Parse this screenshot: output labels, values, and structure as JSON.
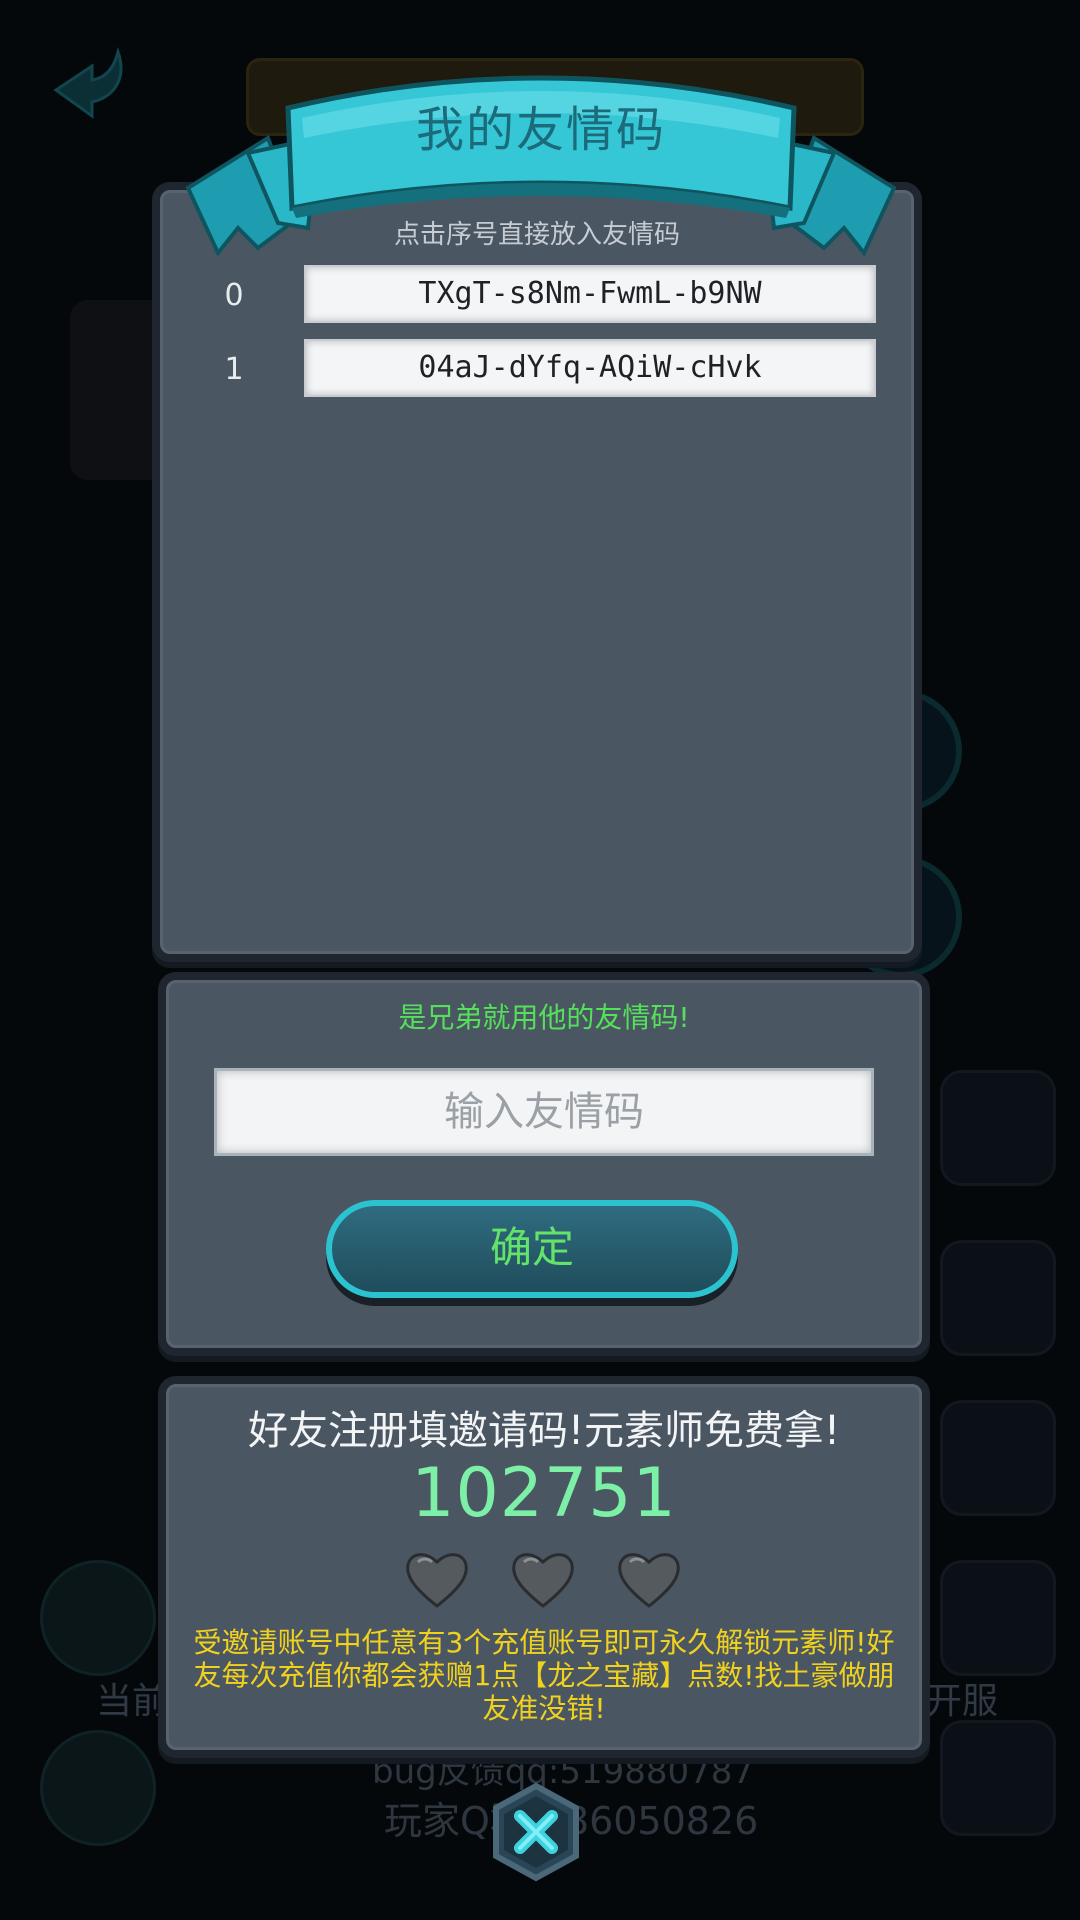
{
  "background": {
    "left_label": "当前",
    "right_label": "开服",
    "bug_line": "bug反馈qq:519880787",
    "player_line": "玩家Q群:486050826"
  },
  "modal": {
    "title": "我的友情码",
    "hint": "点击序号直接放入友情码",
    "codes": [
      {
        "index": "0",
        "code": "TXgT-s8Nm-FwmL-b9NW"
      },
      {
        "index": "1",
        "code": "04aJ-dYfq-AQiW-cHvk"
      }
    ]
  },
  "input_panel": {
    "prompt": "是兄弟就用他的友情码!",
    "placeholder": "输入友情码",
    "confirm_label": "确定"
  },
  "invite_panel": {
    "title": "好友注册填邀请码!元素师免费拿!",
    "code": "102751",
    "hearts": 3,
    "description": "受邀请账号中任意有3个充值账号即可永久解锁元素师!好友每次充值你都会获赠1点【龙之宝藏】点数!找土豪做朋友准没错!"
  },
  "colors": {
    "panel": "#4b5663",
    "ribbon": "#2fb6c8",
    "prompt_green": "#54e05a",
    "code_green": "#7df0a7",
    "desc_yellow": "#f0d21e"
  },
  "icons": [
    "back-arrow-icon",
    "heart-icon",
    "close-icon"
  ]
}
